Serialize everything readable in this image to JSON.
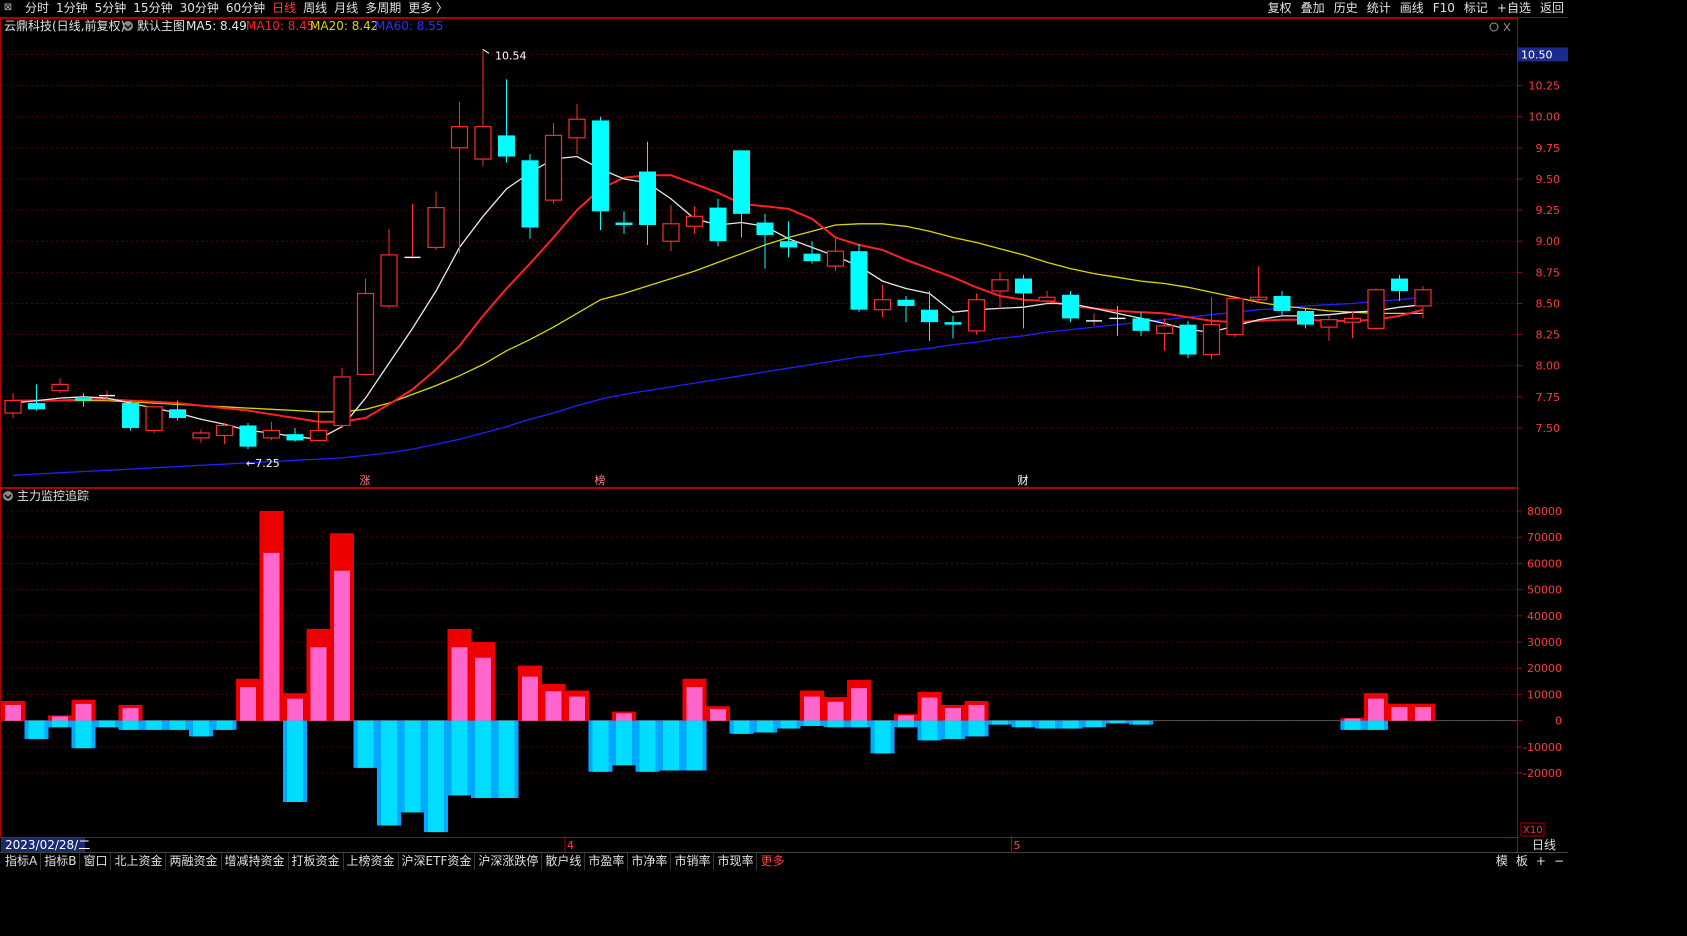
{
  "toolbar": {
    "window_icon": "⊠",
    "periods": [
      "分时",
      "1分钟",
      "5分钟",
      "15分钟",
      "30分钟",
      "60分钟",
      "日线",
      "周线",
      "月线",
      "多周期",
      "更多 〉"
    ],
    "active_period": "日线",
    "tools": [
      "复权",
      "叠加",
      "历史",
      "统计",
      "画线",
      "F10",
      "标记",
      "+自选",
      "返回"
    ]
  },
  "legend": {
    "title": "云鼎科技(日线,前复权)",
    "main_chart": "默认主图",
    "ma5": "MA5: 8.49",
    "ma10": "MA10: 8.45",
    "ma20": "MA20: 8.42",
    "ma60": "MA60: 8.55"
  },
  "indicator_title": "主力监控追踪",
  "event_marks": [
    "涨",
    "榜",
    "财"
  ],
  "date_label": "2023/02/28/二",
  "month_labels": [
    "4",
    "5"
  ],
  "colors": {
    "up": "#ff2a2a",
    "down": "#00ffff",
    "ma5": "#e8e8e8",
    "ma10": "#ff2020",
    "ma20": "#d8d800",
    "ma60": "#2020ff",
    "grid": "#5a0000",
    "axis": "#b00000",
    "pink": "#ff66cc",
    "red_bar": "#ee0000",
    "cyan_bar": "#00ddff"
  },
  "bottom_tabs": [
    "指标A",
    "指标B",
    "窗口",
    "北上资金",
    "两融资金",
    "增减持资金",
    "打板资金",
    "上榜资金",
    "沪深ETF资金",
    "沪深涨跌停",
    "散户线",
    "市盈率",
    "市净率",
    "市销率",
    "市现率",
    "更多"
  ],
  "bottom_right": [
    "模",
    "板",
    "+",
    "−"
  ],
  "chart_data": [
    {
      "type": "candlestick",
      "title": "云鼎科技(日线,前复权)",
      "y_ticks": [
        7.5,
        7.75,
        8.0,
        8.25,
        8.5,
        8.75,
        9.0,
        9.25,
        9.5,
        9.75,
        10.0,
        10.25,
        10.5
      ],
      "y_tick_labels": [
        "7.50",
        "7.75",
        "8.00",
        "8.25",
        "8.50",
        "8.75",
        "9.00",
        "9.25",
        "9.50",
        "9.75",
        "10.00",
        "10.25",
        "10.50"
      ],
      "ylim": [
        7.05,
        10.6
      ],
      "high_label": "10.54",
      "low_label": "7.25",
      "candles": [
        [
          7.62,
          7.72,
          7.78,
          7.58
        ],
        [
          7.7,
          7.65,
          7.85,
          7.64
        ],
        [
          7.8,
          7.85,
          7.9,
          7.78
        ],
        [
          7.74,
          7.72,
          7.78,
          7.67
        ],
        [
          7.75,
          7.76,
          7.8,
          7.72
        ],
        [
          7.7,
          7.5,
          7.72,
          7.48
        ],
        [
          7.48,
          7.67,
          7.68,
          7.46
        ],
        [
          7.65,
          7.58,
          7.72,
          7.56
        ],
        [
          7.42,
          7.46,
          7.49,
          7.38
        ],
        [
          7.44,
          7.52,
          7.54,
          7.37
        ],
        [
          7.52,
          7.35,
          7.54,
          7.33
        ],
        [
          7.42,
          7.48,
          7.55,
          7.4
        ],
        [
          7.45,
          7.4,
          7.5,
          7.39
        ],
        [
          7.4,
          7.48,
          7.62,
          7.39
        ],
        [
          7.52,
          7.91,
          7.98,
          7.5
        ],
        [
          7.93,
          8.58,
          8.7,
          7.94
        ],
        [
          8.48,
          8.89,
          9.1,
          8.46
        ],
        [
          8.87,
          8.87,
          9.3,
          8.86
        ],
        [
          8.95,
          9.27,
          9.4,
          8.93
        ],
        [
          9.75,
          9.92,
          10.12,
          8.9
        ],
        [
          9.66,
          9.92,
          10.54,
          9.6
        ],
        [
          9.85,
          9.68,
          10.3,
          9.63
        ],
        [
          9.65,
          9.11,
          9.7,
          9.02
        ],
        [
          9.33,
          9.85,
          9.95,
          9.3
        ],
        [
          9.83,
          9.98,
          10.1,
          9.7
        ],
        [
          9.97,
          9.24,
          10.0,
          9.09
        ],
        [
          9.15,
          9.13,
          9.24,
          9.06
        ],
        [
          9.56,
          9.13,
          9.8,
          8.97
        ],
        [
          9.0,
          9.14,
          9.29,
          8.92
        ],
        [
          9.12,
          9.2,
          9.28,
          9.06
        ],
        [
          9.27,
          9.0,
          9.34,
          8.96
        ],
        [
          9.73,
          9.22,
          9.73,
          9.03
        ],
        [
          9.15,
          9.05,
          9.22,
          8.78
        ],
        [
          9.0,
          8.95,
          9.16,
          8.87
        ],
        [
          8.9,
          8.84,
          9.0,
          8.82
        ],
        [
          8.8,
          8.92,
          9.02,
          8.76
        ],
        [
          8.92,
          8.45,
          8.98,
          8.43
        ],
        [
          8.45,
          8.53,
          8.65,
          8.39
        ],
        [
          8.53,
          8.48,
          8.56,
          8.35
        ],
        [
          8.45,
          8.35,
          8.6,
          8.2
        ],
        [
          8.35,
          8.33,
          8.4,
          8.22
        ],
        [
          8.28,
          8.53,
          8.58,
          8.25
        ],
        [
          8.6,
          8.69,
          8.75,
          8.45
        ],
        [
          8.7,
          8.58,
          8.73,
          8.3
        ],
        [
          8.52,
          8.55,
          8.6,
          8.5
        ],
        [
          8.57,
          8.38,
          8.6,
          8.35
        ],
        [
          8.35,
          8.36,
          8.42,
          8.32
        ],
        [
          8.38,
          8.37,
          8.48,
          8.24
        ],
        [
          8.38,
          8.28,
          8.43,
          8.24
        ],
        [
          8.26,
          8.32,
          8.38,
          8.12
        ],
        [
          8.33,
          8.09,
          8.36,
          8.06
        ],
        [
          8.09,
          8.33,
          8.55,
          8.05
        ],
        [
          8.25,
          8.54,
          8.56,
          8.23
        ],
        [
          8.53,
          8.55,
          8.8,
          8.5
        ],
        [
          8.56,
          8.44,
          8.6,
          8.4
        ],
        [
          8.44,
          8.33,
          8.46,
          8.3
        ],
        [
          8.31,
          8.37,
          8.4,
          8.2
        ],
        [
          8.35,
          8.38,
          8.44,
          8.22
        ],
        [
          8.3,
          8.61,
          8.62,
          8.29
        ],
        [
          8.7,
          8.6,
          8.73,
          8.52
        ],
        [
          8.48,
          8.61,
          8.64,
          8.38
        ]
      ],
      "ma5": [
        7.7,
        7.72,
        7.74,
        7.75,
        7.74,
        7.7,
        7.66,
        7.62,
        7.57,
        7.53,
        7.48,
        7.46,
        7.43,
        7.41,
        7.51,
        7.74,
        8.02,
        8.3,
        8.6,
        8.95,
        9.2,
        9.42,
        9.55,
        9.66,
        9.68,
        9.58,
        9.5,
        9.47,
        9.34,
        9.18,
        9.13,
        9.15,
        9.12,
        9.02,
        8.95,
        8.88,
        8.8,
        8.68,
        8.62,
        8.58,
        8.43,
        8.45,
        8.46,
        8.47,
        8.5,
        8.5,
        8.46,
        8.42,
        8.38,
        8.34,
        8.29,
        8.27,
        8.32,
        8.37,
        8.4,
        8.4,
        8.41,
        8.43,
        8.44,
        8.47,
        8.49
      ],
      "ma10": [
        7.72,
        7.72,
        7.72,
        7.73,
        7.73,
        7.72,
        7.71,
        7.7,
        7.68,
        7.66,
        7.64,
        7.61,
        7.58,
        7.55,
        7.55,
        7.58,
        7.69,
        7.81,
        7.97,
        8.16,
        8.4,
        8.62,
        8.82,
        9.03,
        9.25,
        9.42,
        9.51,
        9.53,
        9.53,
        9.46,
        9.39,
        9.3,
        9.28,
        9.26,
        9.18,
        9.03,
        8.97,
        8.93,
        8.85,
        8.78,
        8.71,
        8.63,
        8.56,
        8.53,
        8.52,
        8.48,
        8.46,
        8.44,
        8.43,
        8.42,
        8.39,
        8.36,
        8.35,
        8.36,
        8.37,
        8.37,
        8.36,
        8.36,
        8.37,
        8.4,
        8.45
      ],
      "ma20": [
        7.72,
        7.72,
        7.72,
        7.72,
        7.72,
        7.71,
        7.7,
        7.69,
        7.68,
        7.67,
        7.66,
        7.65,
        7.64,
        7.63,
        7.63,
        7.65,
        7.7,
        7.77,
        7.84,
        7.92,
        8.01,
        8.12,
        8.21,
        8.31,
        8.42,
        8.53,
        8.58,
        8.64,
        8.7,
        8.76,
        8.83,
        8.9,
        8.97,
        9.03,
        9.08,
        9.13,
        9.14,
        9.14,
        9.12,
        9.08,
        9.03,
        8.99,
        8.94,
        8.89,
        8.83,
        8.78,
        8.74,
        8.71,
        8.68,
        8.66,
        8.63,
        8.59,
        8.55,
        8.51,
        8.48,
        8.46,
        8.44,
        8.43,
        8.42,
        8.42,
        8.42
      ],
      "ma60": [
        7.12,
        7.13,
        7.14,
        7.15,
        7.16,
        7.17,
        7.18,
        7.19,
        7.2,
        7.21,
        7.22,
        7.23,
        7.24,
        7.25,
        7.26,
        7.28,
        7.3,
        7.33,
        7.37,
        7.41,
        7.46,
        7.51,
        7.57,
        7.62,
        7.68,
        7.73,
        7.77,
        7.8,
        7.83,
        7.86,
        7.89,
        7.92,
        7.95,
        7.98,
        8.01,
        8.04,
        8.07,
        8.09,
        8.12,
        8.14,
        8.17,
        8.19,
        8.22,
        8.24,
        8.27,
        8.29,
        8.31,
        8.33,
        8.35,
        8.37,
        8.39,
        8.41,
        8.43,
        8.45,
        8.46,
        8.48,
        8.49,
        8.5,
        8.52,
        8.53,
        8.55
      ]
    },
    {
      "type": "bar",
      "title": "主力监控追踪",
      "y_ticks": [
        -20000,
        -10000,
        0,
        10000,
        20000,
        30000,
        40000,
        50000,
        60000,
        70000,
        80000
      ],
      "y_tick_labels": [
        "-20000",
        "-10000",
        "0",
        "10000",
        "20000",
        "30000",
        "40000",
        "50000",
        "60000",
        "70000",
        "80000"
      ],
      "ylim": [
        -44000,
        88000
      ],
      "unit": "X10",
      "series": [
        {
          "values": [
            7500,
            0,
            2000,
            8000,
            0,
            6000,
            0,
            0,
            0,
            0,
            16000,
            80000,
            10500,
            35000,
            71500,
            0,
            0,
            0,
            0,
            35000,
            30000,
            0,
            21000,
            14000,
            11500,
            0,
            3500,
            0,
            0,
            16000,
            5500,
            0,
            0,
            0,
            11500,
            9000,
            15500,
            0,
            2500,
            11000,
            6000,
            7500,
            0,
            0,
            0,
            0,
            0,
            0,
            0,
            0,
            0,
            0,
            0,
            0,
            0,
            0,
            0,
            1000,
            10500,
            6500,
            6500
          ]
        },
        {
          "values": [
            0,
            -7000,
            -2500,
            -10500,
            -2500,
            -3500,
            -3500,
            -3500,
            -6000,
            -3500,
            0,
            0,
            -31000,
            0,
            0,
            -18000,
            -40000,
            -35000,
            -42500,
            -28500,
            -29500,
            -29500,
            0,
            0,
            0,
            -19500,
            -17000,
            -19500,
            -19000,
            -19000,
            0,
            -5000,
            -4500,
            -3000,
            -2000,
            -2500,
            -2500,
            -12500,
            -2500,
            -7500,
            -7000,
            -6000,
            -1500,
            -2500,
            -3000,
            -3000,
            -2500,
            -1000,
            -1500,
            0,
            0,
            0,
            0,
            0,
            0,
            0,
            0,
            -3500,
            -3500,
            0,
            0
          ]
        }
      ]
    }
  ]
}
